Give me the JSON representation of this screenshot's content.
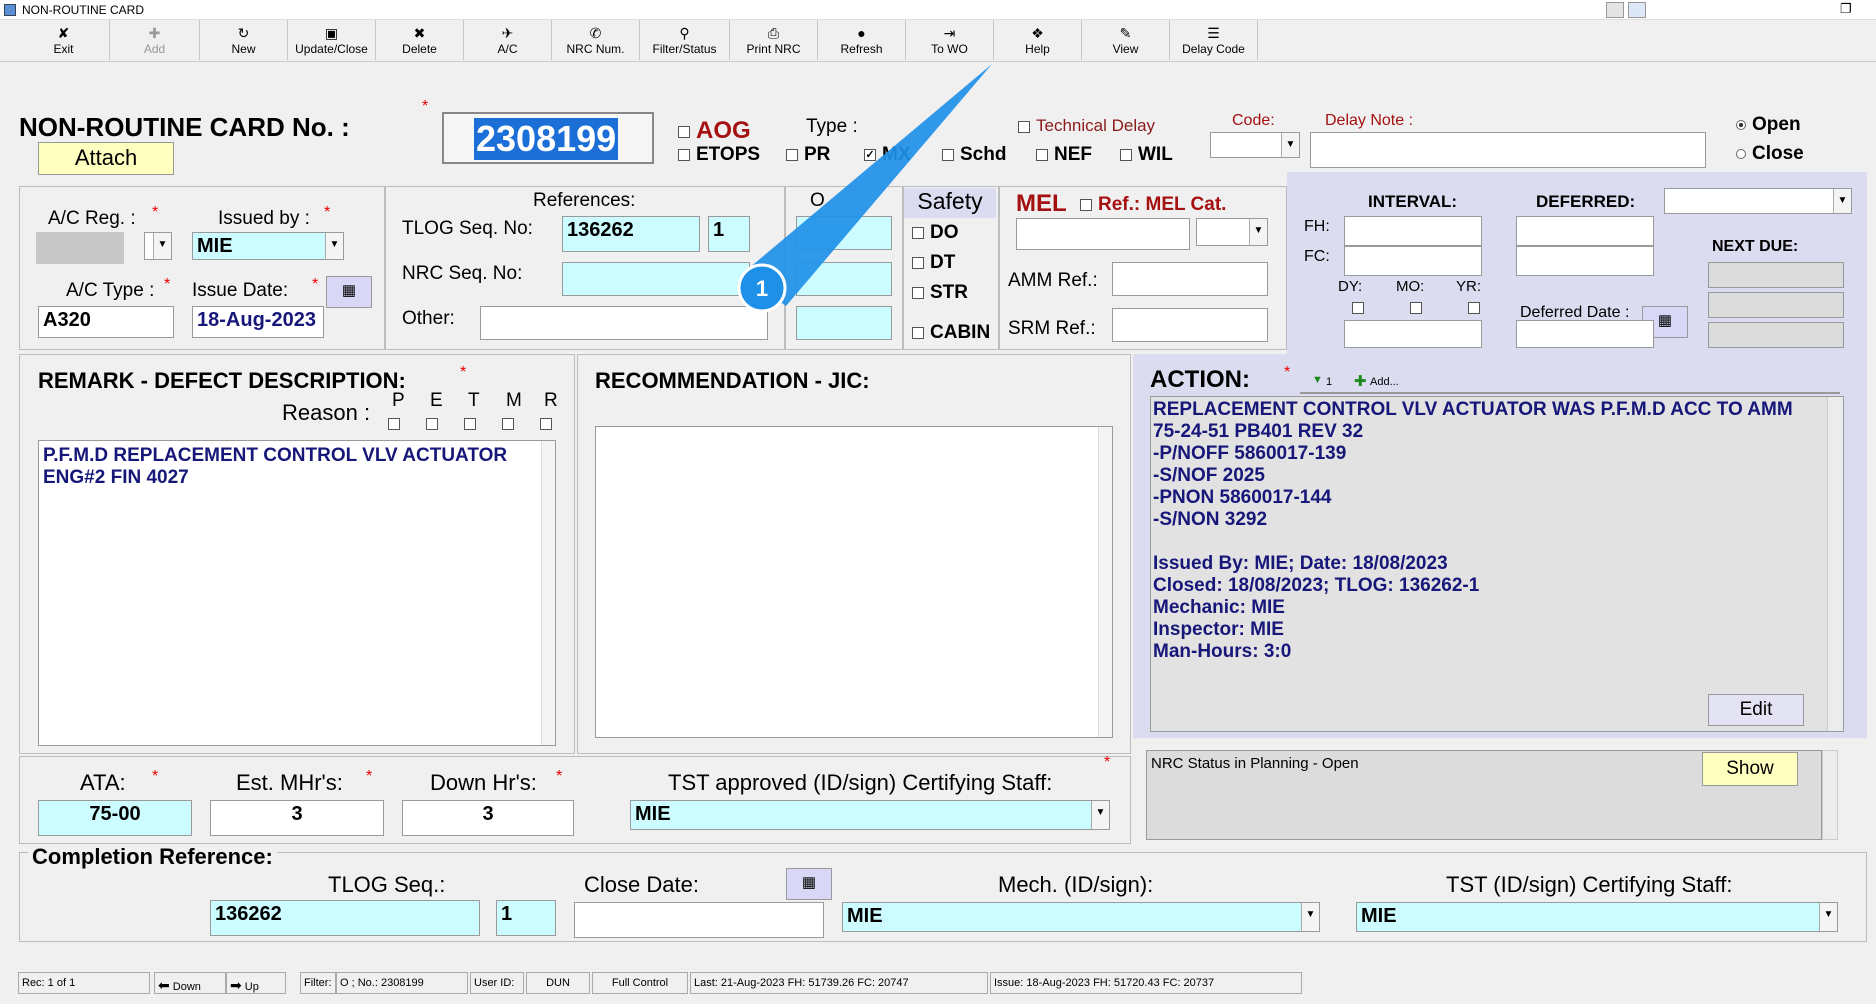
{
  "window": {
    "title": "NON-ROUTINE CARD"
  },
  "toolbar": [
    {
      "label": "Exit",
      "icon": "exit-icon",
      "glyph": "✘",
      "enabled": true
    },
    {
      "label": "Add",
      "icon": "add-icon",
      "glyph": "✚",
      "enabled": false
    },
    {
      "label": "New",
      "icon": "new-icon",
      "glyph": "↻",
      "enabled": true
    },
    {
      "label": "Update/Close",
      "icon": "save-icon",
      "glyph": "▣",
      "enabled": true
    },
    {
      "label": "Delete",
      "icon": "delete-icon",
      "glyph": "✖",
      "enabled": true
    },
    {
      "label": "A/C",
      "icon": "aircraft-icon",
      "glyph": "✈",
      "enabled": true
    },
    {
      "label": "NRC Num.",
      "icon": "nrc-number-icon",
      "glyph": "✆",
      "enabled": true
    },
    {
      "label": "Filter/Status",
      "icon": "filter-icon",
      "glyph": "⚲",
      "enabled": true
    },
    {
      "label": "Print NRC",
      "icon": "print-icon",
      "glyph": "⎙",
      "enabled": true
    },
    {
      "label": "Refresh",
      "icon": "refresh-icon",
      "glyph": "●",
      "enabled": true
    },
    {
      "label": "To WO",
      "icon": "to-wo-icon",
      "glyph": "⇥",
      "enabled": true
    },
    {
      "label": "Help",
      "icon": "help-icon",
      "glyph": "❖",
      "enabled": true
    },
    {
      "label": "View",
      "icon": "view-icon",
      "glyph": "✎",
      "enabled": true
    },
    {
      "label": "Delay Code",
      "icon": "delay-code-icon",
      "glyph": "☰",
      "enabled": true
    }
  ],
  "header": {
    "title": "NON-ROUTINE CARD No. :",
    "card_number": "2308199",
    "attach": "Attach",
    "type_label": "Type :",
    "aog": "AOG",
    "etops": "ETOPS",
    "pr": "PR",
    "mx": "MX",
    "schd": "Schd",
    "nef": "NEF",
    "wil": "WIL",
    "technical_delay": "Technical Delay",
    "code_label": "Code:",
    "delay_note_label": "Delay Note :",
    "open": "Open",
    "close": "Close",
    "status_selected": "Open",
    "mx_checked": true
  },
  "aircraft": {
    "reg_label": "A/C Reg. :",
    "issued_by_label": "Issued by :",
    "issued_by": "MIE",
    "type_label": "A/C Type :",
    "type": "A320",
    "issue_date_label": "Issue Date:",
    "issue_date": "18-Aug-2023"
  },
  "references": {
    "title": "References:",
    "tlog_label": "TLOG Seq. No:",
    "tlog_seq": "136262",
    "tlog_item": "1",
    "nrc_label": "NRC Seq. No:",
    "other_label": "Other:",
    "o_label": "O"
  },
  "safety": {
    "title": "Safety",
    "do": "DO",
    "dt": "DT",
    "str": "STR",
    "cabin": "CABIN"
  },
  "mel": {
    "title": "MEL",
    "ref_label": "Ref.: MEL Cat.",
    "amm_label": "AMM Ref.:",
    "srm_label": "SRM Ref.:"
  },
  "interval": {
    "interval_label": "INTERVAL:",
    "deferred_label": "DEFERRED:",
    "fh": "FH:",
    "fc": "FC:",
    "dy": "DY:",
    "mo": "MO:",
    "yr": "YR:",
    "deferred_date_label": "Deferred Date :",
    "next_due": "NEXT DUE:"
  },
  "remark": {
    "title": "REMARK - DEFECT DESCRIPTION:",
    "reason_label": "Reason :",
    "reasons": [
      "P",
      "E",
      "T",
      "M",
      "R"
    ],
    "text_line1": "P.F.M.D REPLACEMENT CONTROL VLV ACTUATOR",
    "text_line2": "ENG#2 FIN 4027"
  },
  "recommendation": {
    "title": "RECOMMENDATION - JIC:"
  },
  "action": {
    "title": "ACTION:",
    "count": "1",
    "add": "Add...",
    "lines": [
      "REPLACEMENT CONTROL VLV ACTUATOR WAS P.F.M.D ACC TO AMM",
      "75-24-51 PB401 REV 32",
      "-P/NOFF 5860017-139",
      "-S/NOF 2025",
      "-PNON 5860017-144",
      "-S/NON 3292",
      "",
      "Issued By: MIE; Date: 18/08/2023",
      "Closed: 18/08/2023;  TLOG: 136262-1",
      "Mechanic: MIE",
      "Inspector: MIE",
      "Man-Hours: 3:0"
    ],
    "edit": "Edit"
  },
  "metrics": {
    "ata_label": "ATA:",
    "ata": "75-00",
    "est_label": "Est. MHr's:",
    "est": "3",
    "down_label": "Down Hr's:",
    "down": "3",
    "tst_label": "TST approved (ID/sign) Certifying Staff:",
    "tst": "MIE"
  },
  "planning": {
    "status": "NRC Status in Planning - Open",
    "show": "Show"
  },
  "completion": {
    "title": "Completion Reference:",
    "tlog_label": "TLOG Seq.:",
    "tlog": "136262",
    "tlog_item": "1",
    "close_date_label": "Close Date:",
    "mech_label": "Mech. (ID/sign):",
    "mech": "MIE",
    "tst_label": "TST (ID/sign) Certifying Staff:",
    "tst": "MIE"
  },
  "statusbar": {
    "rec": "Rec: 1 of 1",
    "down": "Down",
    "up": "Up",
    "filter_label": "Filter:",
    "filter": "O ; No.: 2308199",
    "user_label": "User ID:",
    "user": "DUN",
    "access": "Full Control",
    "last": "Last: 21-Aug-2023 FH: 51739.26 FC: 20747",
    "issue": "Issue: 18-Aug-2023 FH: 51720.43 FC: 20737"
  },
  "callout": {
    "number": "1"
  },
  "colors": {
    "accent_cyan": "#ccfcff",
    "action_text": "#17177a",
    "aog": "#a51010",
    "callout": "#1e90e8",
    "panel_lavender": "#dcdcf0"
  }
}
